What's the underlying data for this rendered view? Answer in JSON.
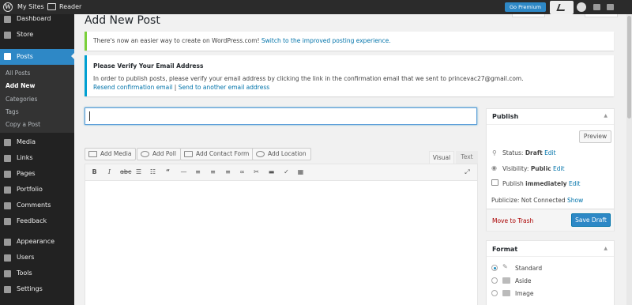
{
  "topbar": {
    "my_sites": "My Sites",
    "reader": "Reader",
    "go_premium": "Go Premium"
  },
  "sidebar": {
    "items": [
      {
        "label": "Dashboard",
        "icon": "dashboard-icon"
      },
      {
        "label": "Store",
        "icon": "cart-icon"
      },
      {
        "label": "Posts",
        "icon": "pin-icon"
      },
      {
        "label": "Media",
        "icon": "media-icon"
      },
      {
        "label": "Links",
        "icon": "link-icon"
      },
      {
        "label": "Pages",
        "icon": "pages-icon"
      },
      {
        "label": "Portfolio",
        "icon": "portfolio-icon"
      },
      {
        "label": "Comments",
        "icon": "comment-icon"
      },
      {
        "label": "Feedback",
        "icon": "feedback-icon"
      },
      {
        "label": "Appearance",
        "icon": "brush-icon"
      },
      {
        "label": "Users",
        "icon": "users-icon"
      },
      {
        "label": "Tools",
        "icon": "wrench-icon"
      },
      {
        "label": "Settings",
        "icon": "settings-icon"
      }
    ],
    "submenu": [
      "All Posts",
      "Add New",
      "Categories",
      "Tags",
      "Copy a Post"
    ]
  },
  "page": {
    "title": "Add New Post"
  },
  "notice1": {
    "text": "There's now an easier way to create on WordPress.com! ",
    "link": "Switch to the improved posting experience."
  },
  "notice2": {
    "title": "Please Verify Your Email Address",
    "body": "In order to publish posts, please verify your email address by clicking the link in the confirmation email that we sent to princevac27@gmail.com.",
    "resend": "Resend confirmation email",
    "sep": "|",
    "send_other": "Send to another email address"
  },
  "editor": {
    "title_value": "",
    "buttons": {
      "add_media": "Add Media",
      "add_poll": "Add Poll",
      "add_contact_form": "Add Contact Form",
      "add_location": "Add Location"
    },
    "tabs": {
      "visual": "Visual",
      "text": "Text"
    }
  },
  "publish": {
    "heading": "Publish",
    "preview": "Preview",
    "status_label": "Status:",
    "status_value": "Draft",
    "edit": "Edit",
    "visibility_label": "Visibility:",
    "visibility_value": "Public",
    "publish_label": "Publish",
    "publish_value": "immediately",
    "publicize": "Publicize: Not Connected",
    "show": "Show",
    "trash": "Move to Trash",
    "save_draft": "Save Draft"
  },
  "format": {
    "heading": "Format",
    "options": [
      "Standard",
      "Aside",
      "Image"
    ],
    "selected": "Standard"
  },
  "colors": {
    "accent": "#2e88c6",
    "sidebar": "#222222",
    "notice_green": "#7ad03a",
    "notice_blue": "#00a0d2"
  }
}
